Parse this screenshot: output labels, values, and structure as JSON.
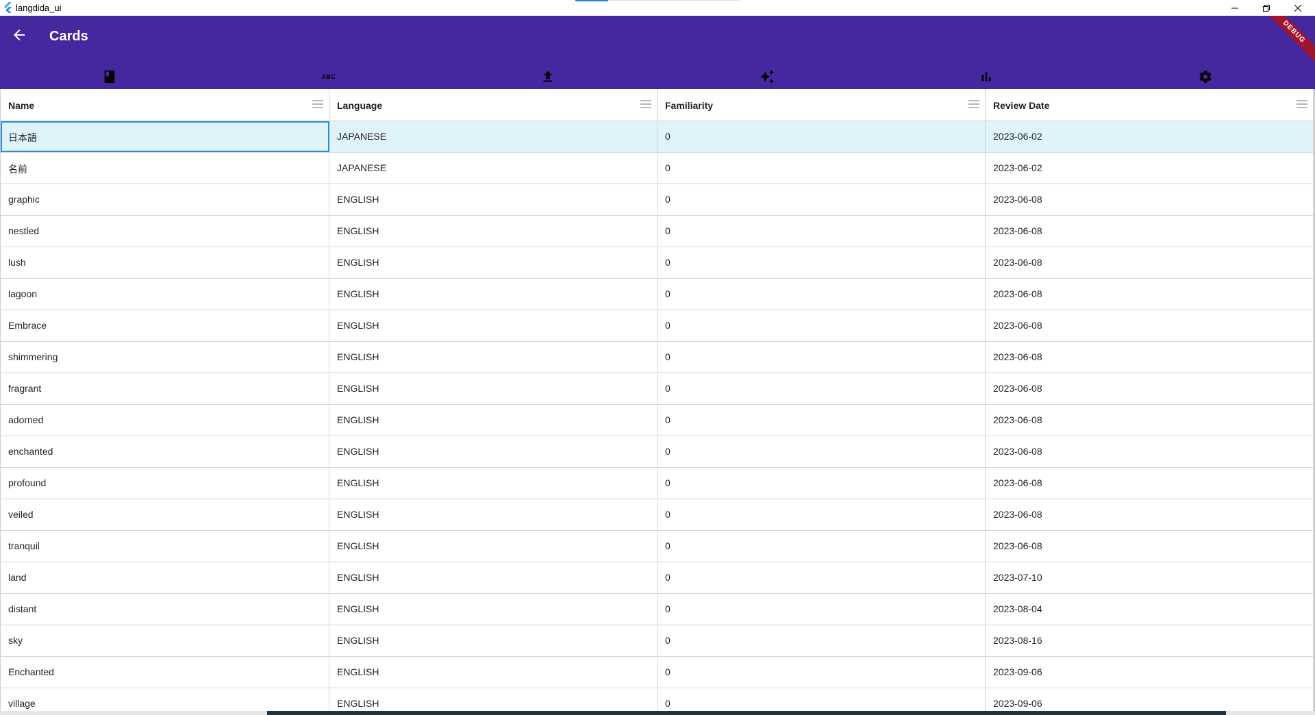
{
  "window": {
    "title": "langdida_ui"
  },
  "appbar": {
    "title": "Cards",
    "debug_label": "DEBUG"
  },
  "tabs": [
    {
      "icon": "book-icon"
    },
    {
      "icon": "abc-icon",
      "text": "ABC"
    },
    {
      "icon": "upload-icon"
    },
    {
      "icon": "sparkle-icon"
    },
    {
      "icon": "bar-chart-icon"
    },
    {
      "icon": "gear-icon"
    }
  ],
  "table": {
    "columns": [
      "Name",
      "Language",
      "Familiarity",
      "Review Date"
    ],
    "rows": [
      [
        "日本語",
        "JAPANESE",
        "0",
        "2023-06-02"
      ],
      [
        "名前",
        "JAPANESE",
        "0",
        "2023-06-02"
      ],
      [
        "graphic",
        "ENGLISH",
        "0",
        "2023-06-08"
      ],
      [
        "nestled",
        "ENGLISH",
        "0",
        "2023-06-08"
      ],
      [
        "lush",
        "ENGLISH",
        "0",
        "2023-06-08"
      ],
      [
        "lagoon",
        "ENGLISH",
        "0",
        "2023-06-08"
      ],
      [
        "Embrace",
        "ENGLISH",
        "0",
        "2023-06-08"
      ],
      [
        "shimmering",
        "ENGLISH",
        "0",
        "2023-06-08"
      ],
      [
        "fragrant",
        "ENGLISH",
        "0",
        "2023-06-08"
      ],
      [
        "adorned",
        "ENGLISH",
        "0",
        "2023-06-08"
      ],
      [
        "enchanted",
        "ENGLISH",
        "0",
        "2023-06-08"
      ],
      [
        "profound",
        "ENGLISH",
        "0",
        "2023-06-08"
      ],
      [
        "veiled",
        "ENGLISH",
        "0",
        "2023-06-08"
      ],
      [
        "tranquil",
        "ENGLISH",
        "0",
        "2023-06-08"
      ],
      [
        "land",
        "ENGLISH",
        "0",
        "2023-07-10"
      ],
      [
        "distant",
        "ENGLISH",
        "0",
        "2023-08-04"
      ],
      [
        "sky",
        "ENGLISH",
        "0",
        "2023-08-16"
      ],
      [
        "Enchanted",
        "ENGLISH",
        "0",
        "2023-09-06"
      ],
      [
        "village",
        "ENGLISH",
        "0",
        "2023-09-06"
      ]
    ],
    "selected_row": 0
  },
  "colors": {
    "appbar": "#4527a0",
    "selected_row": "#dff3fa",
    "focus_border": "#2b8cd8",
    "ribbon": "#a3142a"
  }
}
